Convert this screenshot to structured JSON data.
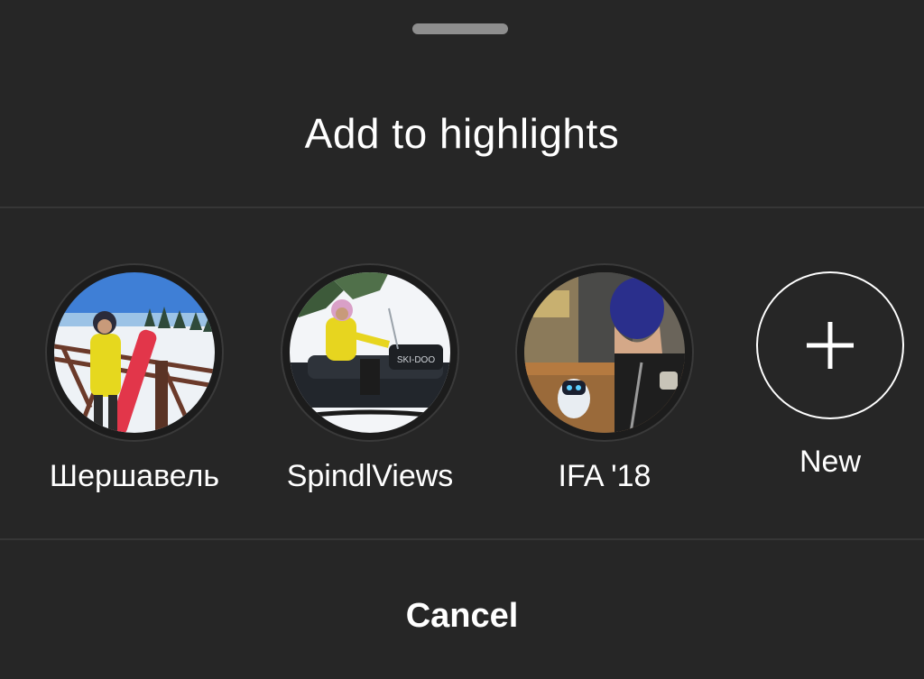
{
  "sheet": {
    "title": "Add to highlights",
    "cancel_label": "Cancel"
  },
  "highlights": [
    {
      "label": "Шершавель",
      "icon": "snowboarder-photo"
    },
    {
      "label": "SpindlViews",
      "icon": "snowmobile-photo"
    },
    {
      "label": "IFA '18",
      "icon": "robot-photo"
    }
  ],
  "new_highlight": {
    "label": "New",
    "icon": "plus-icon"
  },
  "colors": {
    "background": "#262626",
    "text": "#ffffff",
    "divider": "#363636",
    "handle": "#8e8e8e"
  }
}
